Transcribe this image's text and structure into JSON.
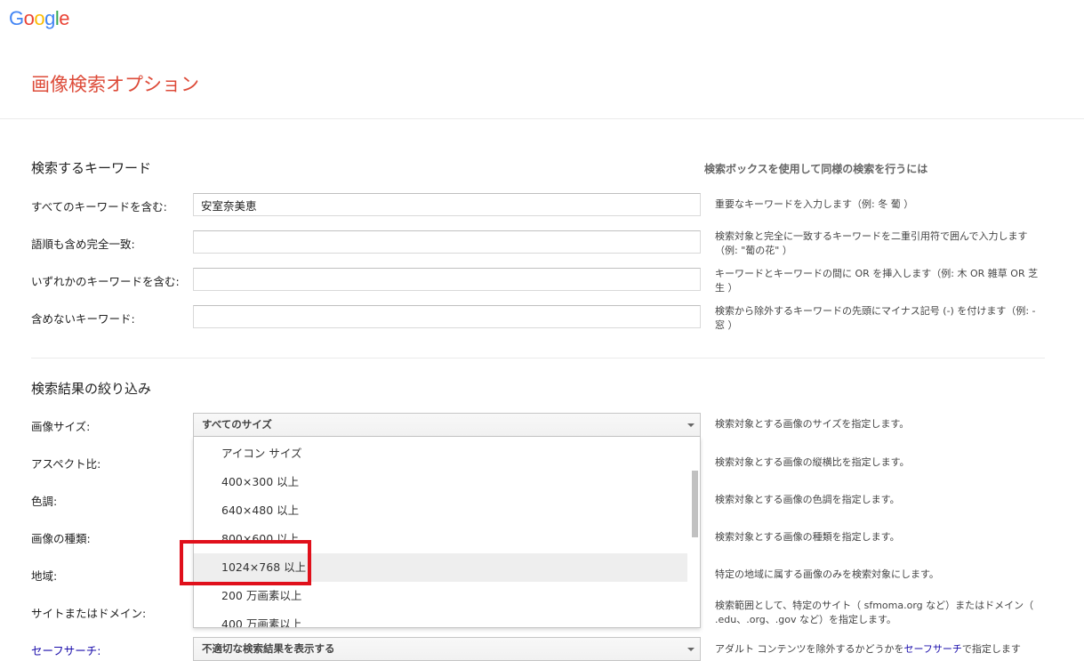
{
  "brand": {
    "logo_text": [
      "G",
      "o",
      "o",
      "g",
      "l",
      "e"
    ],
    "logo_colors": [
      "#4285f4",
      "#ea4335",
      "#fbbc05",
      "#4285f4",
      "#34a853",
      "#ea4335"
    ]
  },
  "page": {
    "title": "画像検索オプション"
  },
  "keywords_section": {
    "title": "検索するキーワード",
    "help_header": "検索ボックスを使用して同様の検索を行うには",
    "rows": [
      {
        "label": "すべてのキーワードを含む:",
        "value": "安室奈美恵",
        "help": "重要なキーワードを入力します（例: 冬  葡 ）"
      },
      {
        "label": "語順も含め完全一致:",
        "value": "",
        "help": "検索対象と完全に一致するキーワードを二重引用符で囲んで入力します（例: \"葡の花\" ）"
      },
      {
        "label": "いずれかのキーワードを含む:",
        "value": "",
        "help": "キーワードとキーワードの間に OR を挿入します（例: 木 OR 雑草 OR 芝生 ）"
      },
      {
        "label": "含めないキーワード:",
        "value": "",
        "help": "検索から除外するキーワードの先頭にマイナス記号 (-) を付けます（例: -窓 ）"
      }
    ]
  },
  "filter_section": {
    "title": "検索結果の絞り込み",
    "rows": [
      {
        "label": "画像サイズ:",
        "help": "検索対象とする画像のサイズを指定します。"
      },
      {
        "label": "アスペクト比:",
        "help": "検索対象とする画像の縦横比を指定します。"
      },
      {
        "label": "色調:",
        "help": "検索対象とする画像の色調を指定します。"
      },
      {
        "label": "画像の種類:",
        "help": "検索対象とする画像の種類を指定します。"
      },
      {
        "label": "地域:",
        "help": "特定の地域に属する画像のみを検索対象にします。"
      },
      {
        "label": "サイトまたはドメイン:",
        "help": "検索範囲として、特定のサイト（ sfmoma.org など）またはドメイン（ .edu、.org、.gov など）を指定します。"
      },
      {
        "label": "セーフサーチ:",
        "help_prefix": "アダルト コンテンツを除外するかどうかを",
        "help_link": "セーフサーチ",
        "help_suffix": "で指定します"
      }
    ],
    "size_select": {
      "value": "すべてのサイズ",
      "options": [
        "アイコン サイズ",
        "400×300 以上",
        "640×480 以上",
        "800×600 以上",
        "1024×768 以上",
        "200 万画素以上",
        "400 万画素以上"
      ],
      "hovered_index": 4
    },
    "safesearch_select": {
      "value": "不適切な検索結果を表示する"
    }
  }
}
